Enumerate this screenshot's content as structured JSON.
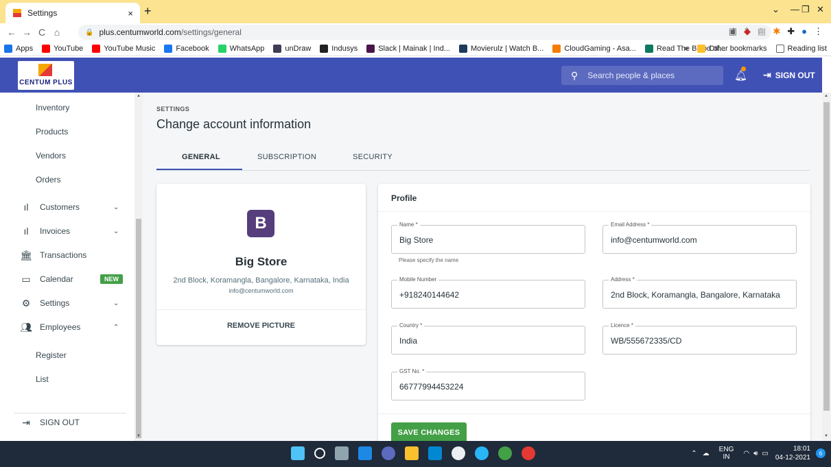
{
  "browser": {
    "tab_title": "Settings",
    "tab_close": "×",
    "new_tab": "+",
    "url_host": "plus.centumworld.com",
    "url_path": "/settings/general",
    "bookmarks": [
      {
        "label": "Apps",
        "color": "#1a73e8"
      },
      {
        "label": "YouTube",
        "color": "#ff0000"
      },
      {
        "label": "YouTube Music",
        "color": "#ff0000"
      },
      {
        "label": "Facebook",
        "color": "#1877f2"
      },
      {
        "label": "WhatsApp",
        "color": "#25d366"
      },
      {
        "label": "unDraw",
        "color": "#3f3d56"
      },
      {
        "label": "Indusys",
        "color": "#202124"
      },
      {
        "label": "Slack | Mainak | Ind...",
        "color": "#4a154b"
      },
      {
        "label": "Movierulz | Watch B...",
        "color": "#1e3a5f"
      },
      {
        "label": "CloudGaming - Asa...",
        "color": "#f57c00"
      },
      {
        "label": "Read The Blood of...",
        "color": "#0d7a5f"
      }
    ],
    "more_bookmarks": "»",
    "other_bookmarks": "Other bookmarks",
    "reading_list": "Reading list"
  },
  "header": {
    "logo_text": "CENTUM PLUS",
    "search_placeholder": "Search people & places",
    "sign_out": "SIGN OUT"
  },
  "sidebar": {
    "items": [
      {
        "label": "Inventory"
      },
      {
        "label": "Products"
      },
      {
        "label": "Vendors"
      },
      {
        "label": "Orders"
      },
      {
        "label": "Customers"
      },
      {
        "label": "Invoices"
      },
      {
        "label": "Transactions"
      },
      {
        "label": "Calendar",
        "badge": "NEW"
      },
      {
        "label": "Settings"
      },
      {
        "label": "Employees"
      },
      {
        "label": "Register"
      },
      {
        "label": "List"
      }
    ],
    "sign_out": "SIGN OUT"
  },
  "main": {
    "breadcrumb": "SETTINGS",
    "title": "Change account information",
    "tabs": [
      {
        "label": "GENERAL"
      },
      {
        "label": "SUBSCRIPTION"
      },
      {
        "label": "SECURITY"
      }
    ]
  },
  "store_card": {
    "avatar_letter": "B",
    "name": "Big Store",
    "address": "2nd Block, Koramangla, Bangalore, Karnataka, India",
    "email": "info@centumworld.com",
    "remove_picture": "REMOVE PICTURE"
  },
  "profile": {
    "title": "Profile",
    "fields": {
      "name": {
        "label": "Name *",
        "value": "Big Store",
        "helper": "Please specify the name"
      },
      "email": {
        "label": "Email Address *",
        "value": "info@centumworld.com"
      },
      "mobile": {
        "label": "Mobile Number",
        "value": "+918240144642"
      },
      "address": {
        "label": "Address *",
        "value": "2nd Block, Koramangla, Bangalore, Karnataka"
      },
      "country": {
        "label": "Country *",
        "value": "India"
      },
      "licence": {
        "label": "Licence *",
        "value": "WB/555672335/CD"
      },
      "gst": {
        "label": "GST No. *",
        "value": "66777994453224"
      }
    },
    "save_label": "SAVE CHANGES"
  },
  "taskbar": {
    "lang_line1": "ENG",
    "lang_line2": "IN",
    "time": "18:01",
    "date": "04-12-2021",
    "notification_count": "6"
  },
  "colors": {
    "primary": "#3f51b5",
    "success": "#43a047",
    "tab_strip": "#fbe38f"
  }
}
